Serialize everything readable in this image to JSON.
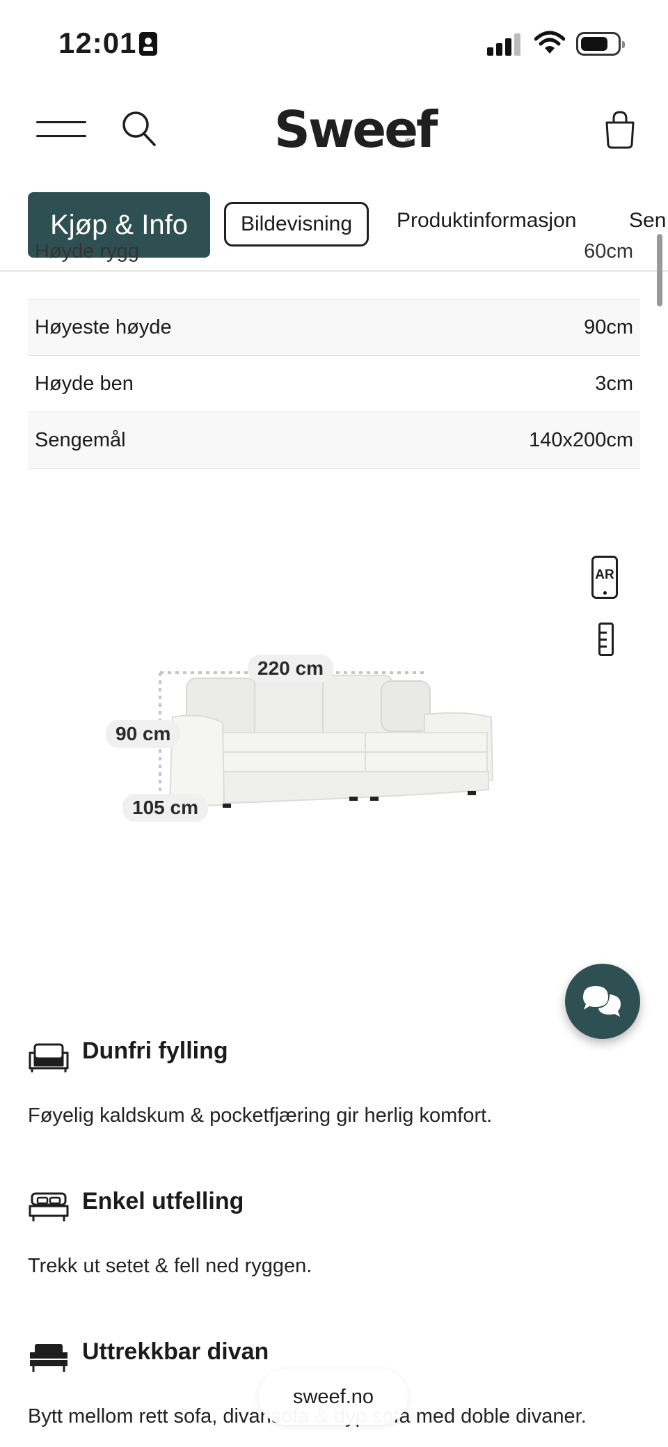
{
  "status_bar": {
    "time": "12:01",
    "icons": [
      "id-card-icon",
      "cellular-signal-icon",
      "wifi-icon",
      "battery-icon"
    ],
    "battery_level": 0.75
  },
  "header": {
    "logo": "Sweef",
    "logo_mark": "®",
    "icons": [
      "hamburger-menu-icon",
      "search-icon",
      "shopping-bag-icon"
    ]
  },
  "tabs": [
    {
      "label": "Kjøp & Info",
      "style": "active"
    },
    {
      "label": "Bildevisning",
      "style": "outlined"
    },
    {
      "label": "Produktinformasjon",
      "style": "plain"
    },
    {
      "label": "Sen",
      "style": "plain"
    }
  ],
  "specs": [
    {
      "key": "Høyde rygg",
      "value": "60cm"
    },
    {
      "key": "Høyeste høyde",
      "value": "90cm"
    },
    {
      "key": "Høyde ben",
      "value": "3cm"
    },
    {
      "key": "Sengemål",
      "value": "140x200cm"
    }
  ],
  "viewer": {
    "ar_label": "AR",
    "icons": [
      "ar-phone-icon",
      "ruler-icon"
    ],
    "dimensions": {
      "width": "220 cm",
      "height": "90 cm",
      "depth": "105 cm"
    }
  },
  "chat": {
    "icon": "chat-bubbles-icon",
    "color": "#2f5052"
  },
  "features": [
    {
      "icon": "sofa-icon",
      "title": "Dunfri fylling",
      "text": "Føyelig kaldskum & pocketfjæring gir herlig komfort."
    },
    {
      "icon": "sofa-bed-icon",
      "title": "Enkel utfelling",
      "text": "Trekk ut setet & fell ned ryggen."
    },
    {
      "icon": "divan-icon",
      "title": "Uttrekkbar divan",
      "text": "Bytt mellom rett sofa, divansofa & dyp sofa med doble divaner."
    }
  ],
  "browser": {
    "url": "sweef.no"
  },
  "colors": {
    "accent": "#2f5052",
    "text": "#1b1b1b",
    "row_alt": "#f8f8f8"
  }
}
